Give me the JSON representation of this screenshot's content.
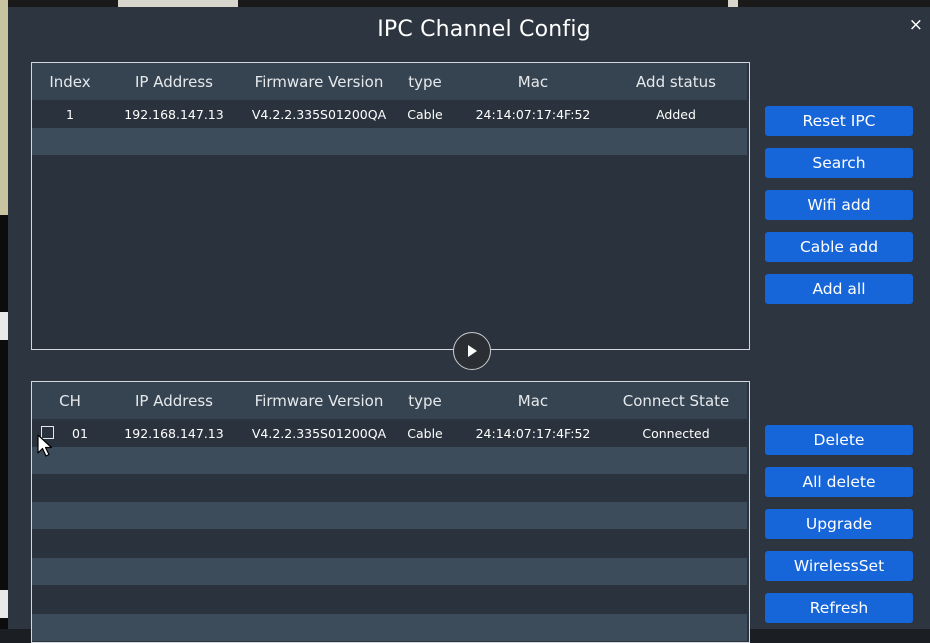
{
  "dialog": {
    "title": "IPC Channel Config",
    "close_glyph": "×"
  },
  "search_table": {
    "headers": [
      "Index",
      "IP Address",
      "Firmware Version",
      "type",
      "Mac",
      "Add status"
    ],
    "rows": [
      {
        "index": "1",
        "ip": "192.168.147.13",
        "firmware": "V4.2.2.335S01200QA",
        "type": "Cable",
        "mac": "24:14:07:17:4F:52",
        "status": "Added"
      }
    ]
  },
  "channel_table": {
    "headers": [
      "CH",
      "IP Address",
      "Firmware Version",
      "type",
      "Mac",
      "Connect State"
    ],
    "rows": [
      {
        "ch": "01",
        "ip": "192.168.147.13",
        "firmware": "V4.2.2.335S01200QA",
        "type": "Cable",
        "mac": "24:14:07:17:4F:52",
        "state": "Connected"
      }
    ]
  },
  "top_buttons": [
    "Reset IPC",
    "Search",
    "Wifi add",
    "Cable add",
    "Add all"
  ],
  "bottom_buttons": [
    "Delete",
    "All delete",
    "Upgrade",
    "WirelessSet",
    "Refresh"
  ],
  "icons": {
    "close": "close-icon",
    "play": "play-icon",
    "cursor": "mouse-pointer-icon"
  },
  "colors": {
    "dialog_bg": "#2d3640",
    "button_bg": "#1766d9",
    "header_bg": "#364451",
    "row_alt": "#3d4c5b"
  }
}
